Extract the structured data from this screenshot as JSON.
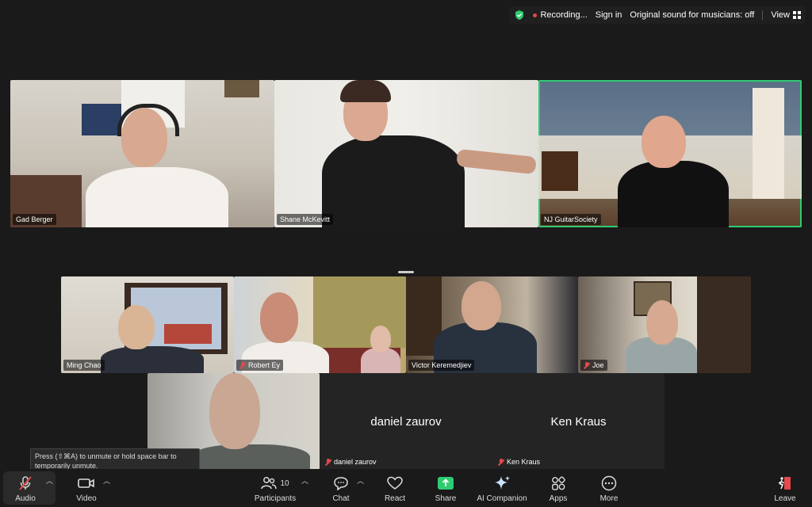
{
  "top_bar": {
    "recording": "Recording...",
    "sign_in": "Sign in",
    "original_sound": "Original sound for musicians: off",
    "view": "View",
    "icons": {
      "security": "shield-check-icon",
      "view": "grid-view-icon"
    }
  },
  "participants_grid": [
    {
      "name": "Gad Berger",
      "muted": false,
      "active_speaker": false
    },
    {
      "name": "Shane McKevitt",
      "muted": false,
      "active_speaker": false
    },
    {
      "name": "NJ GuitarSociety",
      "muted": false,
      "active_speaker": true
    },
    {
      "name": "Ming Chao",
      "muted": false,
      "active_speaker": false
    },
    {
      "name": "Robert Ey",
      "muted": true,
      "active_speaker": false
    },
    {
      "name": "Victor Keremedjiev",
      "muted": false,
      "active_speaker": false
    },
    {
      "name": "Joe",
      "muted": true,
      "active_speaker": false
    },
    {
      "name": "",
      "muted": false,
      "active_speaker": false
    },
    {
      "name": "daniel zaurov",
      "muted": true,
      "video_off": true
    },
    {
      "name": "Ken Kraus",
      "muted": true,
      "video_off": true
    }
  ],
  "tooltip": {
    "line1": "Press  (⇧⌘A) to unmute or hold space bar to",
    "line2": "temporarily unmute."
  },
  "toolbar": {
    "audio": "Audio",
    "video": "Video",
    "participants": "Participants",
    "participants_count": "10",
    "chat": "Chat",
    "react": "React",
    "share": "Share",
    "ai_companion": "AI Companion",
    "apps": "Apps",
    "more": "More",
    "leave": "Leave"
  },
  "colors": {
    "background": "#1a1a1a",
    "active_speaker_border": "#2ecc71",
    "muted_red": "#e5484d",
    "share_green": "#2ecc71",
    "leave_red": "#e5484d"
  }
}
